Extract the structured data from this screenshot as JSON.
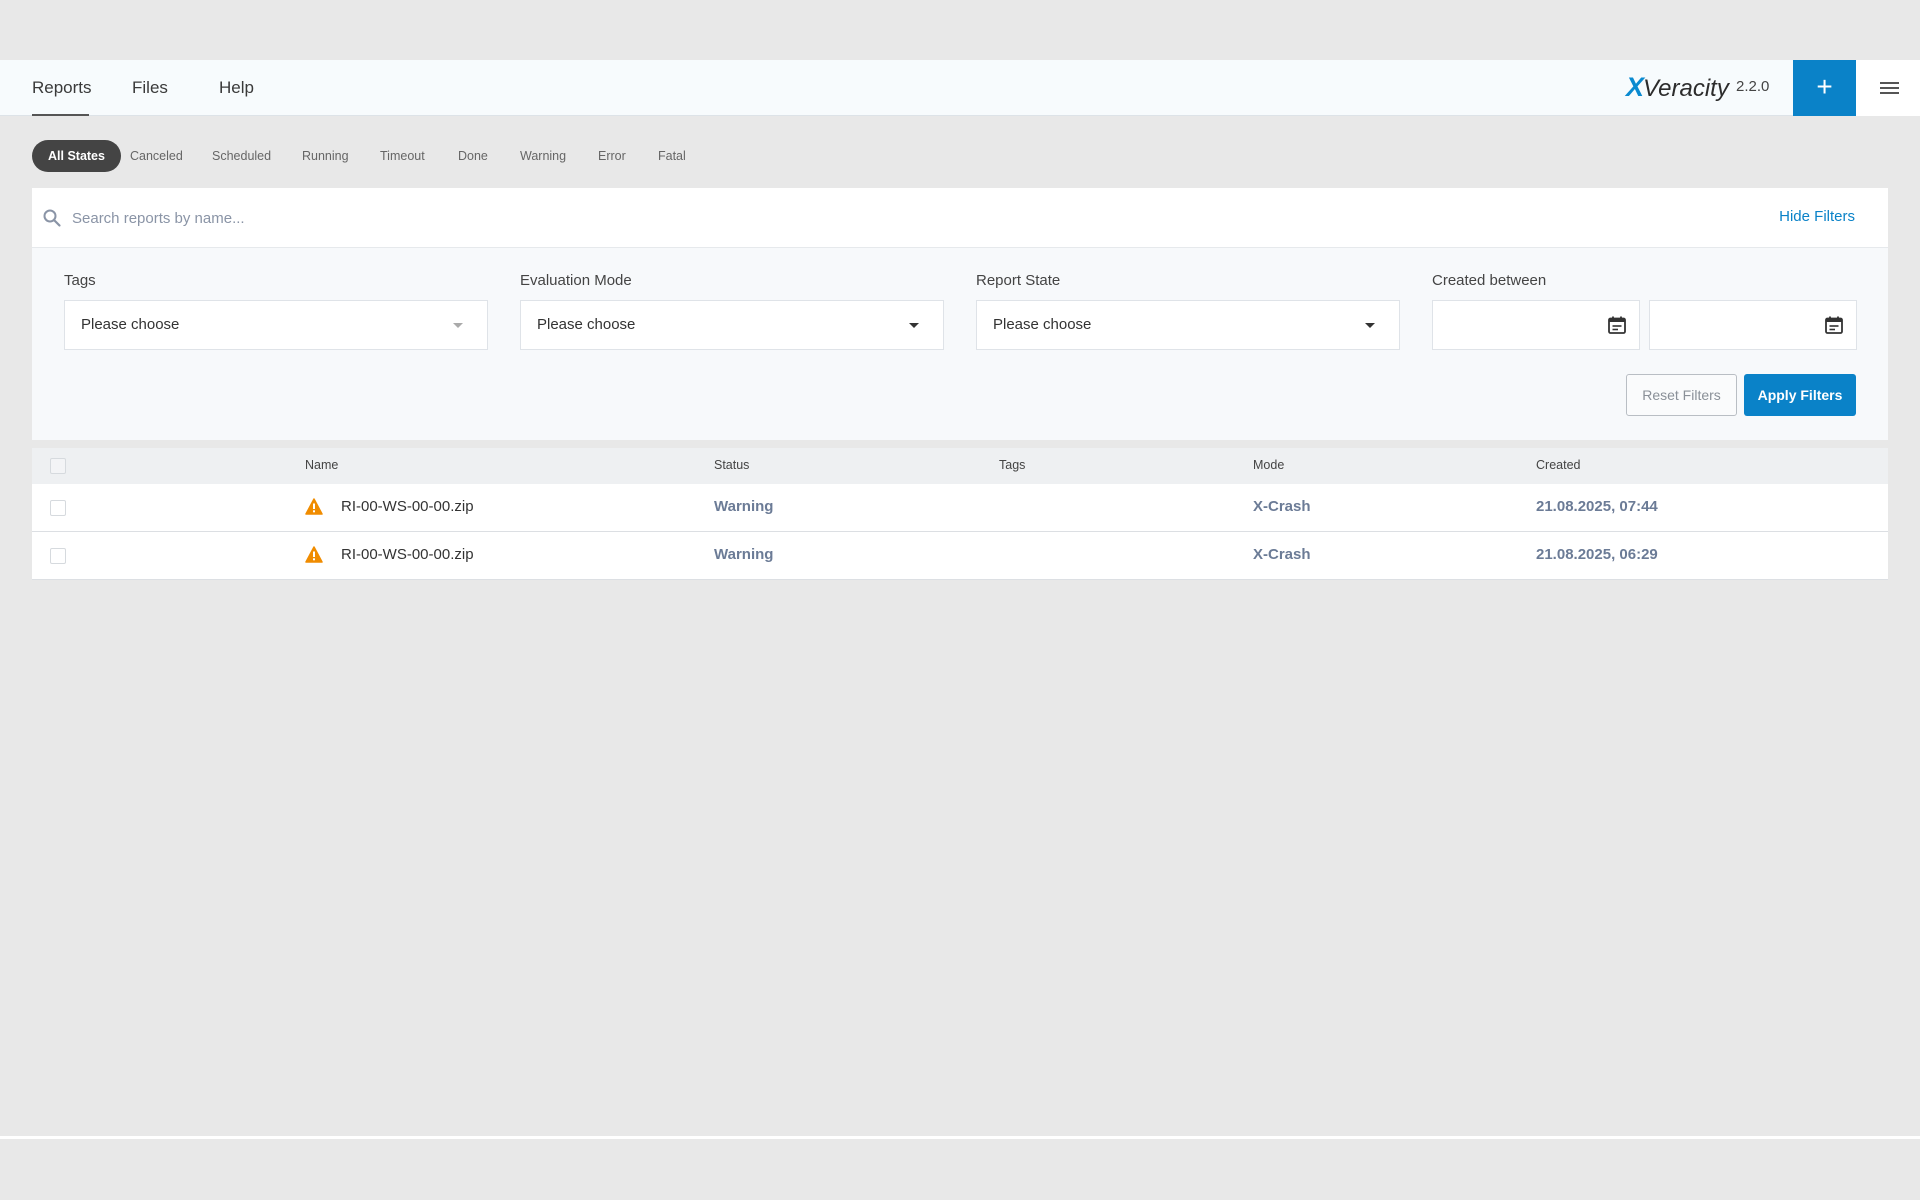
{
  "header": {
    "nav": [
      {
        "label": "Reports",
        "active": true
      },
      {
        "label": "Files",
        "active": false
      },
      {
        "label": "Help",
        "active": false
      }
    ],
    "logo": {
      "x": "X",
      "word": "Veracity"
    },
    "version": "2.2.0",
    "add_label": "+",
    "accent_color": "#0a82c8"
  },
  "states": [
    {
      "label": "All States",
      "active": true
    },
    {
      "label": "Canceled"
    },
    {
      "label": "Scheduled"
    },
    {
      "label": "Running"
    },
    {
      "label": "Timeout"
    },
    {
      "label": "Done"
    },
    {
      "label": "Warning"
    },
    {
      "label": "Error"
    },
    {
      "label": "Fatal"
    }
  ],
  "search": {
    "placeholder": "Search reports by name...",
    "value": ""
  },
  "filters": {
    "hide_label": "Hide Filters",
    "tags": {
      "label": "Tags",
      "value": "Please choose"
    },
    "evaluation_mode": {
      "label": "Evaluation Mode",
      "value": "Please choose"
    },
    "report_state": {
      "label": "Report State",
      "value": "Please choose"
    },
    "created_between": {
      "label": "Created between",
      "from": "",
      "to": ""
    },
    "reset_label": "Reset Filters",
    "apply_label": "Apply Filters"
  },
  "table": {
    "columns": {
      "name": "Name",
      "status": "Status",
      "tags": "Tags",
      "mode": "Mode",
      "created": "Created"
    },
    "rows": [
      {
        "name": "RI-00-WS-00-00.zip",
        "status": "Warning",
        "tags": "",
        "mode": "X-Crash",
        "created": "21.08.2025, 07:44",
        "icon": "warning-triangle-icon"
      },
      {
        "name": "RI-00-WS-00-00.zip",
        "status": "Warning",
        "tags": "",
        "mode": "X-Crash",
        "created": "21.08.2025, 06:29",
        "icon": "warning-triangle-icon"
      }
    ]
  },
  "colors": {
    "warning": "#f08c00",
    "link": "#0a82c8",
    "muted_text": "#6b7b96"
  }
}
